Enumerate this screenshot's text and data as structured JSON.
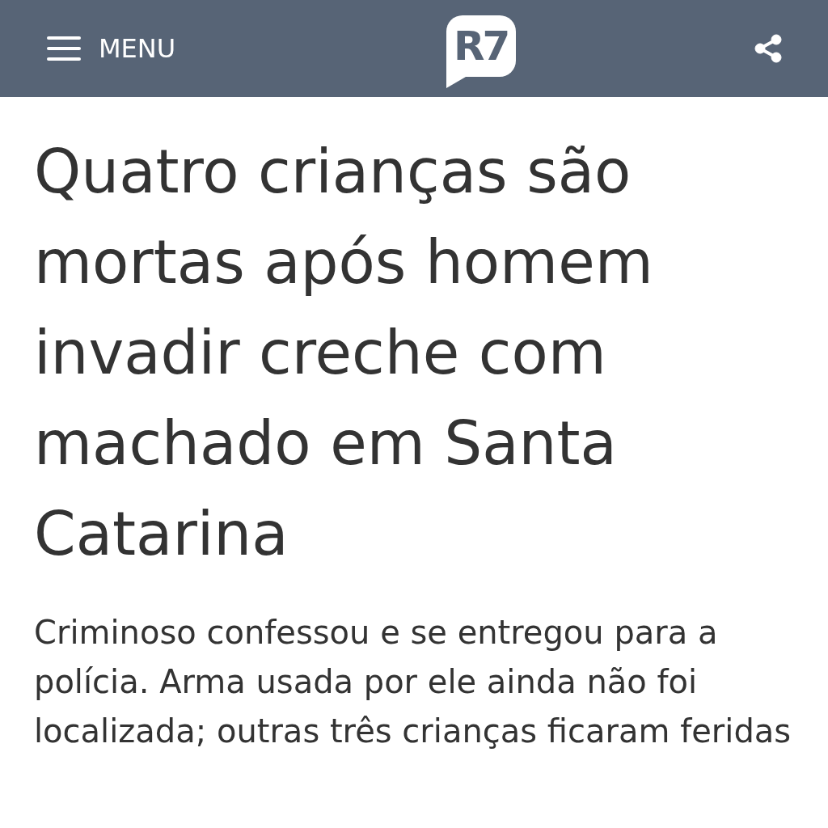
{
  "header": {
    "menu_label": "MENU",
    "logo": "R7"
  },
  "article": {
    "headline": "Quatro crianças são mortas após homem invadir creche com machado em Santa Catarina",
    "subheadline": "Criminoso confessou e se entregou para a polícia. Arma usada por ele ainda não foi localizada; outras três crianças ficaram feridas"
  }
}
